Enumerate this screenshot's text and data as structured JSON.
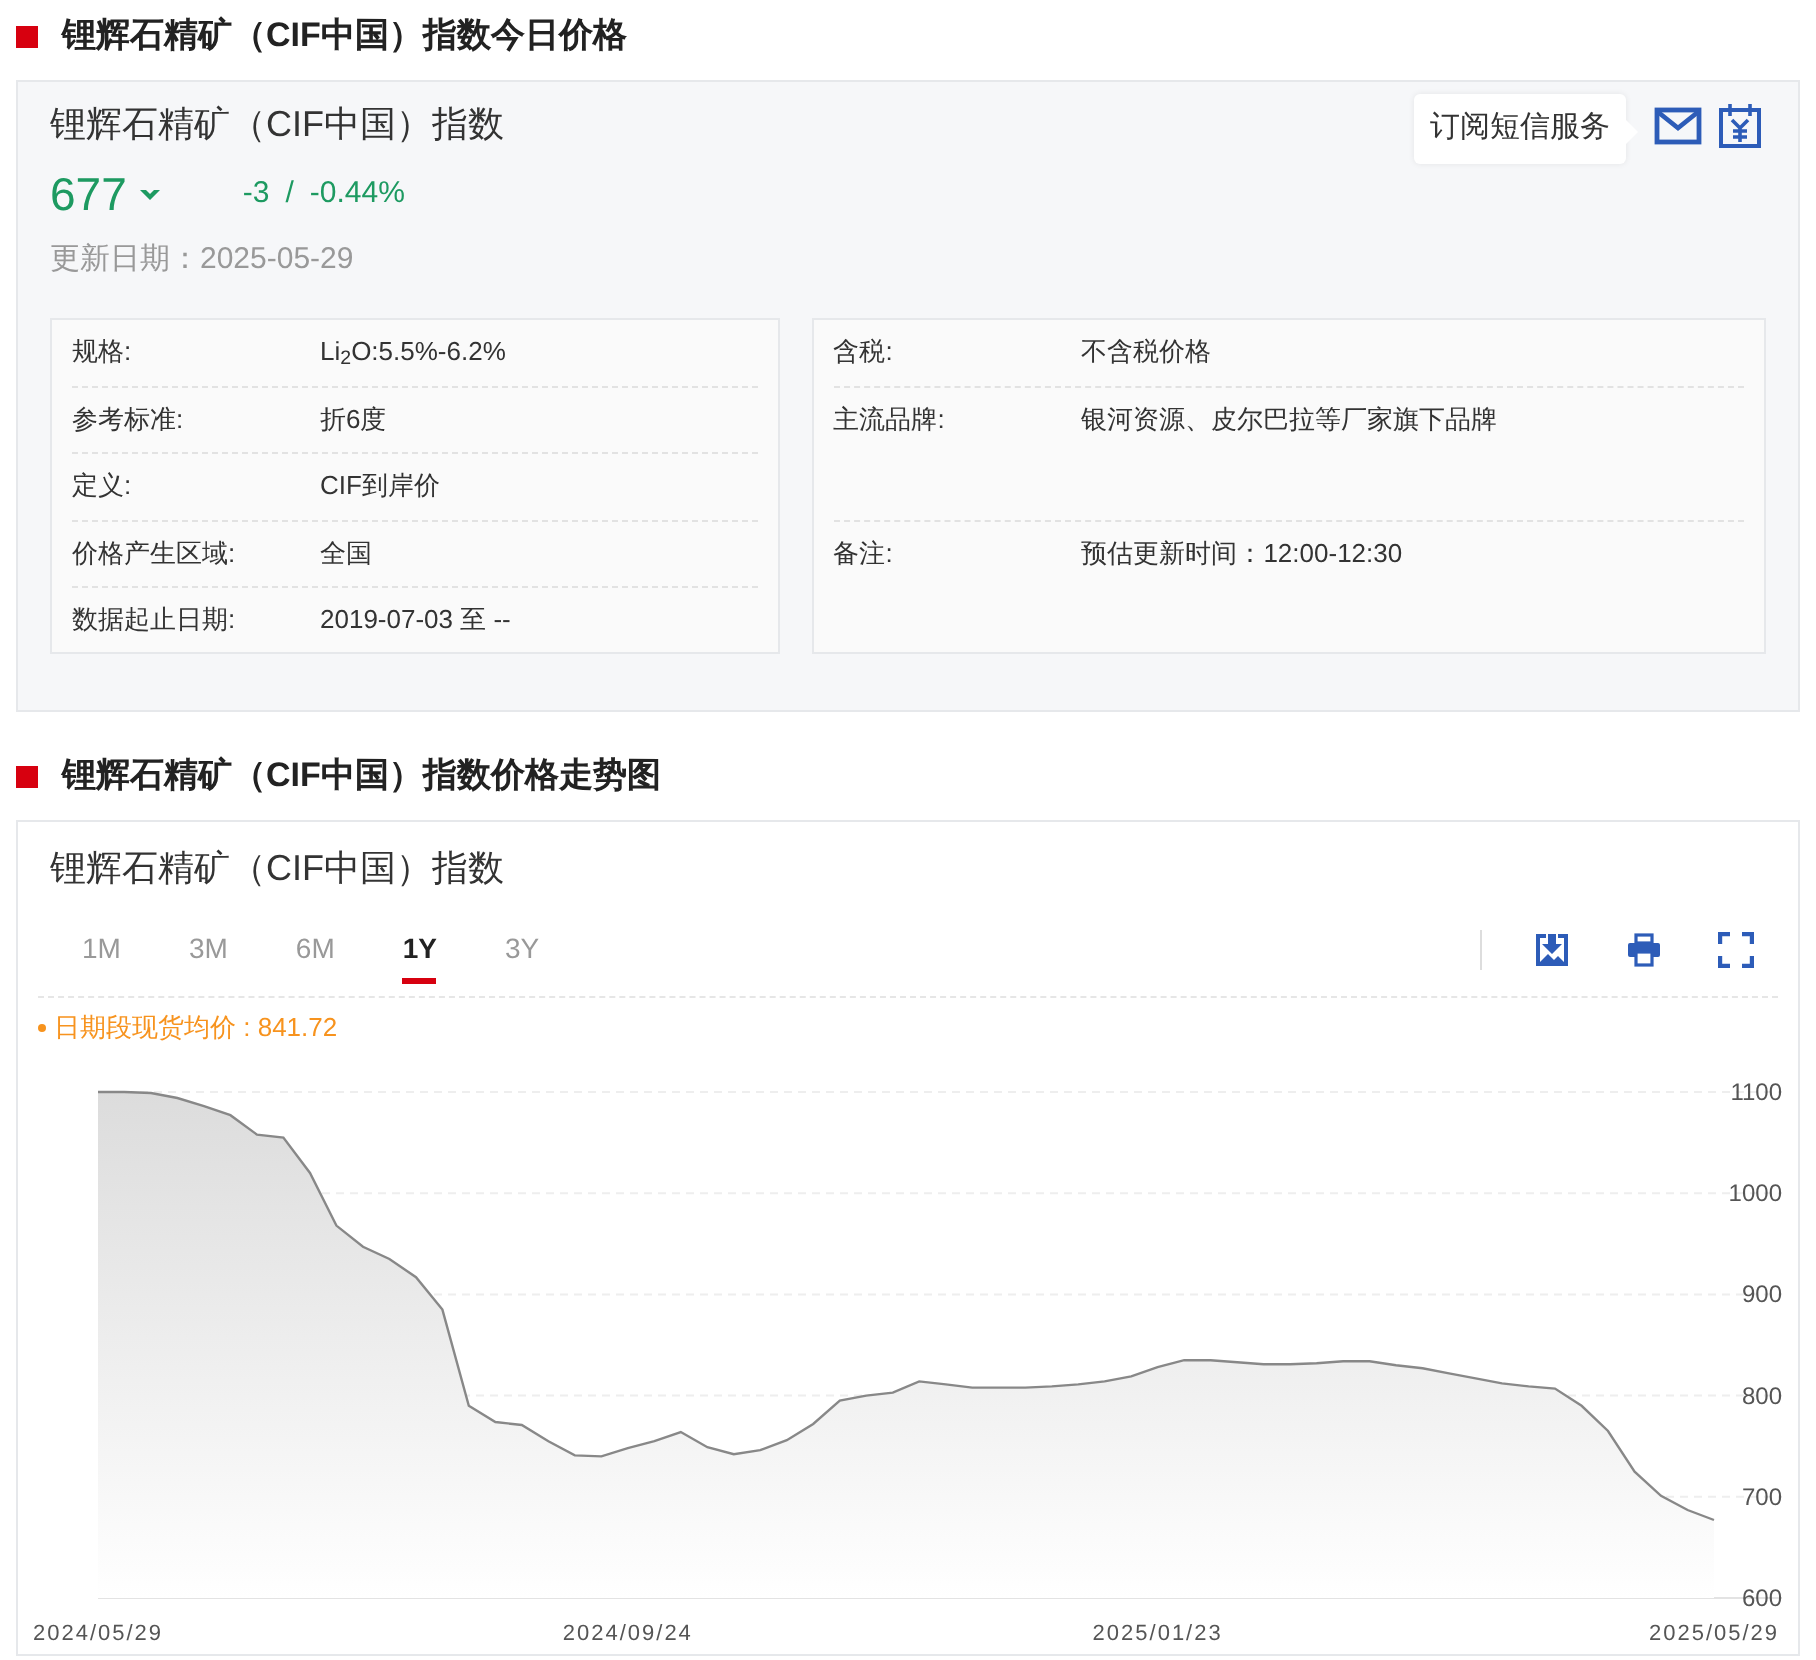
{
  "price_section": {
    "title": "锂辉石精矿（CIF中国）指数今日价格"
  },
  "index_panel": {
    "name": "锂辉石精矿（CIF中国）指数",
    "price": "677",
    "change": "-3",
    "separator": "/",
    "change_percent": "-0.44%",
    "updated": "更新日期：2025-05-29",
    "subscribe_tip": "订阅短信服务"
  },
  "specs_left": [
    {
      "label": "规格:",
      "value": "Li$_{2}$O:5.5%-6.2%"
    },
    {
      "label": "参考标准:",
      "value": "折6度"
    },
    {
      "label": "定义:",
      "value": "CIF到岸价"
    },
    {
      "label": "价格产生区域:",
      "value": "全国"
    },
    {
      "label": "数据起止日期:",
      "value": "2019-07-03 至 --"
    }
  ],
  "specs_right": [
    {
      "label": "含税:",
      "value": "不含税价格",
      "tall": false
    },
    {
      "label": "主流品牌:",
      "value": "银河资源、皮尔巴拉等厂家旗下品牌",
      "tall": true
    },
    {
      "label": "备注:",
      "value": "预估更新时间：12:00-12:30",
      "tall": true
    }
  ],
  "trend_section": {
    "title": "锂辉石精矿（CIF中国）指数价格走势图"
  },
  "chart_card": {
    "title": "锂辉石精矿（CIF中国）指数",
    "ranges": [
      {
        "label": "1M",
        "selected": false
      },
      {
        "label": "3M",
        "selected": false
      },
      {
        "label": "6M",
        "selected": false
      },
      {
        "label": "1Y",
        "selected": true
      },
      {
        "label": "3Y",
        "selected": false
      }
    ],
    "legend": {
      "label": "日期段现货均价 : 841.72",
      "color": "#f7931e"
    },
    "chart_data": {
      "type": "area",
      "categories": [
        "2024/05/29",
        null,
        null,
        null,
        null,
        null,
        null,
        null,
        null,
        null,
        null,
        null,
        null,
        null,
        null,
        null,
        null,
        null,
        null,
        null,
        "2024/09/24",
        null,
        null,
        null,
        null,
        null,
        null,
        null,
        null,
        null,
        null,
        null,
        null,
        null,
        null,
        null,
        null,
        null,
        null,
        null,
        "2025/01/23",
        null,
        null,
        null,
        null,
        null,
        null,
        null,
        null,
        null,
        null,
        null,
        null,
        null,
        null,
        null,
        null,
        null,
        null,
        null,
        null,
        "2025/05/29"
      ],
      "series": [
        {
          "color": "#888888",
          "values": [
            1100,
            1100,
            1099,
            1094,
            1086,
            1077,
            1058,
            1055,
            1020,
            968,
            947,
            935,
            917,
            885,
            790,
            774,
            771,
            755,
            741,
            740,
            748,
            755,
            764,
            749,
            742,
            746,
            756,
            772,
            795,
            800,
            803,
            814,
            811,
            808,
            808,
            808,
            809,
            811,
            814,
            819,
            828,
            835,
            835,
            833,
            831,
            831,
            832,
            834,
            834,
            830,
            827,
            822,
            817,
            812,
            809,
            807,
            790,
            765,
            725,
            701,
            687,
            677
          ]
        }
      ],
      "ylim": [
        600,
        1100
      ],
      "grid": true,
      "yticks": [
        600,
        700,
        800,
        900,
        1000,
        1100
      ]
    }
  }
}
